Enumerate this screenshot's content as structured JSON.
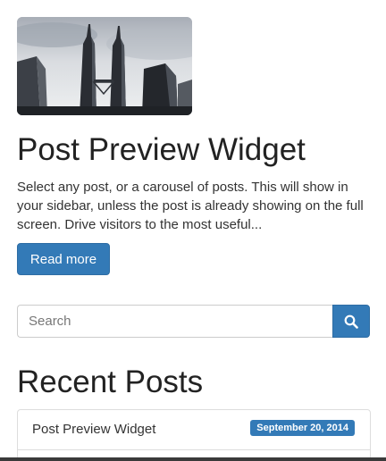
{
  "post": {
    "image_alt": "Petronas Twin Towers photo",
    "title": "Post Preview Widget",
    "excerpt": "Select any post, or a carousel of posts. This will show in your sidebar, unless the post is already showing on the full screen. Drive visitors to the most useful...",
    "read_more_label": "Read more"
  },
  "search": {
    "placeholder": "Search",
    "button_icon": "search-icon"
  },
  "recent_posts": {
    "heading": "Recent Posts",
    "items": [
      {
        "title": "Post Preview Widget",
        "date": "September 20, 2014"
      }
    ]
  },
  "colors": {
    "primary": "#337ab7",
    "heading_text": "#222222",
    "body_text": "#333333"
  }
}
